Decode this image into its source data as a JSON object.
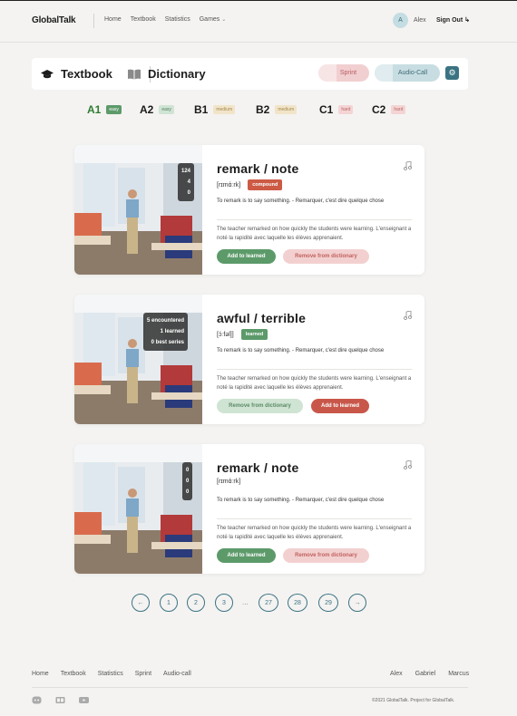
{
  "header": {
    "logo": "GlobalTalk",
    "nav": [
      {
        "label": "Home"
      },
      {
        "label": "Textbook"
      },
      {
        "label": "Statistics"
      },
      {
        "label": "Games"
      }
    ],
    "user_initial": "A",
    "user_name": "Alex",
    "signout_label": "Sign Out"
  },
  "section": {
    "textbook_label": "Textbook",
    "dictionary_label": "Dictionary",
    "sprint_label": "Sprint",
    "audio_label": "Audio-Call"
  },
  "levels": [
    {
      "name": "A1",
      "badge": "easy",
      "active": true
    },
    {
      "name": "A2",
      "badge": "easy"
    },
    {
      "name": "B1",
      "badge": "medium"
    },
    {
      "name": "B2",
      "badge": "medium"
    },
    {
      "name": "C1",
      "badge": "hard"
    },
    {
      "name": "C2",
      "badge": "hard"
    }
  ],
  "cards": [
    {
      "word": "remark / note",
      "transcription": "[rɪmɑ́ːrk]",
      "tag": "compound",
      "stats": [
        "124",
        "4",
        "0"
      ],
      "meaning": "To remark is to say something. - Remarquer, c'est dire quelque chose",
      "example": "The teacher remarked on how quickly the students were learning. L'enseignant a noté la rapidité avec laquelle les élèves apprenaient.",
      "btn1": "Add to learned",
      "btn2": "Remove from dictionary"
    },
    {
      "word": "awful / terrible",
      "transcription": "[ɔ́ːfəl]]",
      "tag": "learned",
      "stats": [
        "5 encountered",
        "1 learned",
        "0 best series"
      ],
      "meaning": "To remark is to say something. - Remarquer, c'est dire quelque chose",
      "example": "The teacher remarked on how quickly the students were learning. L'enseignant a noté la rapidité avec laquelle les élèves apprenaient.",
      "btn1": "Remove from dictionary",
      "btn2": "Add to learned"
    },
    {
      "word": "remark / note",
      "transcription": "[rɪmɑ́ːrk]",
      "stats": [
        "0",
        "0",
        "0"
      ],
      "meaning": "To remark is to say something. - Remarquer, c'est dire quelque chose",
      "example": "The teacher remarked on how quickly the students were learning. L'enseignant a noté la rapidité avec laquelle les élèves apprenaient.",
      "btn1": "Add to learned",
      "btn2": "Remove from dictionary"
    }
  ],
  "pagination": {
    "prev": "←",
    "pages": [
      "1",
      "2",
      "3",
      "27",
      "28",
      "29"
    ],
    "dots": "...",
    "next": "→"
  },
  "footer": {
    "links": [
      "Home",
      "Textbook",
      "Statistics",
      "Sprint",
      "Audio-call"
    ],
    "devs": [
      "Alex",
      "Gabriel",
      "Marcus"
    ],
    "copyright": "©2021 GlobalTalk. Project for GlobalTalk."
  },
  "colors": {
    "accent": "#3b7383",
    "green": "#5c9a6a",
    "red": "#c8574a"
  }
}
